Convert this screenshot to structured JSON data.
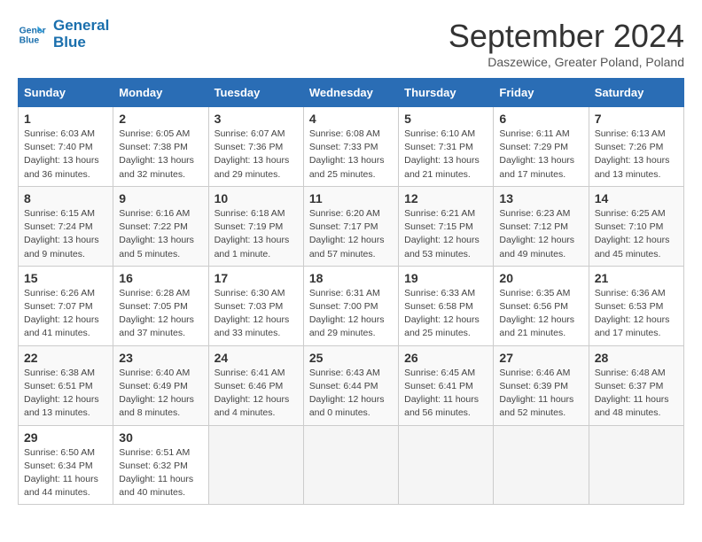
{
  "logo": {
    "line1": "General",
    "line2": "Blue"
  },
  "title": "September 2024",
  "subtitle": "Daszewice, Greater Poland, Poland",
  "weekdays": [
    "Sunday",
    "Monday",
    "Tuesday",
    "Wednesday",
    "Thursday",
    "Friday",
    "Saturday"
  ],
  "weeks": [
    [
      {
        "day": "1",
        "info": "Sunrise: 6:03 AM\nSunset: 7:40 PM\nDaylight: 13 hours\nand 36 minutes."
      },
      {
        "day": "2",
        "info": "Sunrise: 6:05 AM\nSunset: 7:38 PM\nDaylight: 13 hours\nand 32 minutes."
      },
      {
        "day": "3",
        "info": "Sunrise: 6:07 AM\nSunset: 7:36 PM\nDaylight: 13 hours\nand 29 minutes."
      },
      {
        "day": "4",
        "info": "Sunrise: 6:08 AM\nSunset: 7:33 PM\nDaylight: 13 hours\nand 25 minutes."
      },
      {
        "day": "5",
        "info": "Sunrise: 6:10 AM\nSunset: 7:31 PM\nDaylight: 13 hours\nand 21 minutes."
      },
      {
        "day": "6",
        "info": "Sunrise: 6:11 AM\nSunset: 7:29 PM\nDaylight: 13 hours\nand 17 minutes."
      },
      {
        "day": "7",
        "info": "Sunrise: 6:13 AM\nSunset: 7:26 PM\nDaylight: 13 hours\nand 13 minutes."
      }
    ],
    [
      {
        "day": "8",
        "info": "Sunrise: 6:15 AM\nSunset: 7:24 PM\nDaylight: 13 hours\nand 9 minutes."
      },
      {
        "day": "9",
        "info": "Sunrise: 6:16 AM\nSunset: 7:22 PM\nDaylight: 13 hours\nand 5 minutes."
      },
      {
        "day": "10",
        "info": "Sunrise: 6:18 AM\nSunset: 7:19 PM\nDaylight: 13 hours\nand 1 minute."
      },
      {
        "day": "11",
        "info": "Sunrise: 6:20 AM\nSunset: 7:17 PM\nDaylight: 12 hours\nand 57 minutes."
      },
      {
        "day": "12",
        "info": "Sunrise: 6:21 AM\nSunset: 7:15 PM\nDaylight: 12 hours\nand 53 minutes."
      },
      {
        "day": "13",
        "info": "Sunrise: 6:23 AM\nSunset: 7:12 PM\nDaylight: 12 hours\nand 49 minutes."
      },
      {
        "day": "14",
        "info": "Sunrise: 6:25 AM\nSunset: 7:10 PM\nDaylight: 12 hours\nand 45 minutes."
      }
    ],
    [
      {
        "day": "15",
        "info": "Sunrise: 6:26 AM\nSunset: 7:07 PM\nDaylight: 12 hours\nand 41 minutes."
      },
      {
        "day": "16",
        "info": "Sunrise: 6:28 AM\nSunset: 7:05 PM\nDaylight: 12 hours\nand 37 minutes."
      },
      {
        "day": "17",
        "info": "Sunrise: 6:30 AM\nSunset: 7:03 PM\nDaylight: 12 hours\nand 33 minutes."
      },
      {
        "day": "18",
        "info": "Sunrise: 6:31 AM\nSunset: 7:00 PM\nDaylight: 12 hours\nand 29 minutes."
      },
      {
        "day": "19",
        "info": "Sunrise: 6:33 AM\nSunset: 6:58 PM\nDaylight: 12 hours\nand 25 minutes."
      },
      {
        "day": "20",
        "info": "Sunrise: 6:35 AM\nSunset: 6:56 PM\nDaylight: 12 hours\nand 21 minutes."
      },
      {
        "day": "21",
        "info": "Sunrise: 6:36 AM\nSunset: 6:53 PM\nDaylight: 12 hours\nand 17 minutes."
      }
    ],
    [
      {
        "day": "22",
        "info": "Sunrise: 6:38 AM\nSunset: 6:51 PM\nDaylight: 12 hours\nand 13 minutes."
      },
      {
        "day": "23",
        "info": "Sunrise: 6:40 AM\nSunset: 6:49 PM\nDaylight: 12 hours\nand 8 minutes."
      },
      {
        "day": "24",
        "info": "Sunrise: 6:41 AM\nSunset: 6:46 PM\nDaylight: 12 hours\nand 4 minutes."
      },
      {
        "day": "25",
        "info": "Sunrise: 6:43 AM\nSunset: 6:44 PM\nDaylight: 12 hours\nand 0 minutes."
      },
      {
        "day": "26",
        "info": "Sunrise: 6:45 AM\nSunset: 6:41 PM\nDaylight: 11 hours\nand 56 minutes."
      },
      {
        "day": "27",
        "info": "Sunrise: 6:46 AM\nSunset: 6:39 PM\nDaylight: 11 hours\nand 52 minutes."
      },
      {
        "day": "28",
        "info": "Sunrise: 6:48 AM\nSunset: 6:37 PM\nDaylight: 11 hours\nand 48 minutes."
      }
    ],
    [
      {
        "day": "29",
        "info": "Sunrise: 6:50 AM\nSunset: 6:34 PM\nDaylight: 11 hours\nand 44 minutes."
      },
      {
        "day": "30",
        "info": "Sunrise: 6:51 AM\nSunset: 6:32 PM\nDaylight: 11 hours\nand 40 minutes."
      },
      {
        "day": "",
        "info": ""
      },
      {
        "day": "",
        "info": ""
      },
      {
        "day": "",
        "info": ""
      },
      {
        "day": "",
        "info": ""
      },
      {
        "day": "",
        "info": ""
      }
    ]
  ]
}
